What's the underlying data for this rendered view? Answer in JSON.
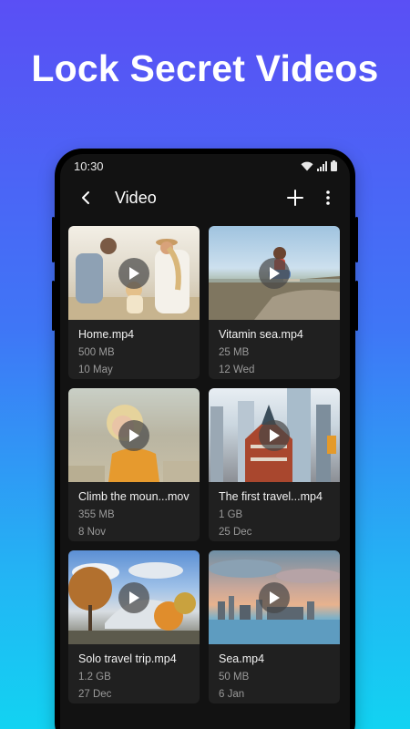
{
  "promo": {
    "title": "Lock Secret Videos"
  },
  "status_bar": {
    "time": "10:30"
  },
  "app_bar": {
    "title": "Video"
  },
  "videos": [
    {
      "name": "Home.mp4",
      "size": "500 MB",
      "date": "10 May"
    },
    {
      "name": "Vitamin sea.mp4",
      "size": "25 MB",
      "date": "12 Wed"
    },
    {
      "name": "Climb the moun...mov",
      "size": "355 MB",
      "date": "8 Nov"
    },
    {
      "name": "The first travel...mp4",
      "size": "1 GB",
      "date": "25 Dec"
    },
    {
      "name": "Solo travel trip.mp4",
      "size": "1.2 GB",
      "date": "27 Dec"
    },
    {
      "name": "Sea.mp4",
      "size": "50 MB",
      "date": "6 Jan"
    }
  ],
  "colors": {
    "gradient_top": "#5a4ff5",
    "gradient_bottom": "#12d3f2",
    "screen_bg": "#121212",
    "card_bg": "#202020"
  }
}
